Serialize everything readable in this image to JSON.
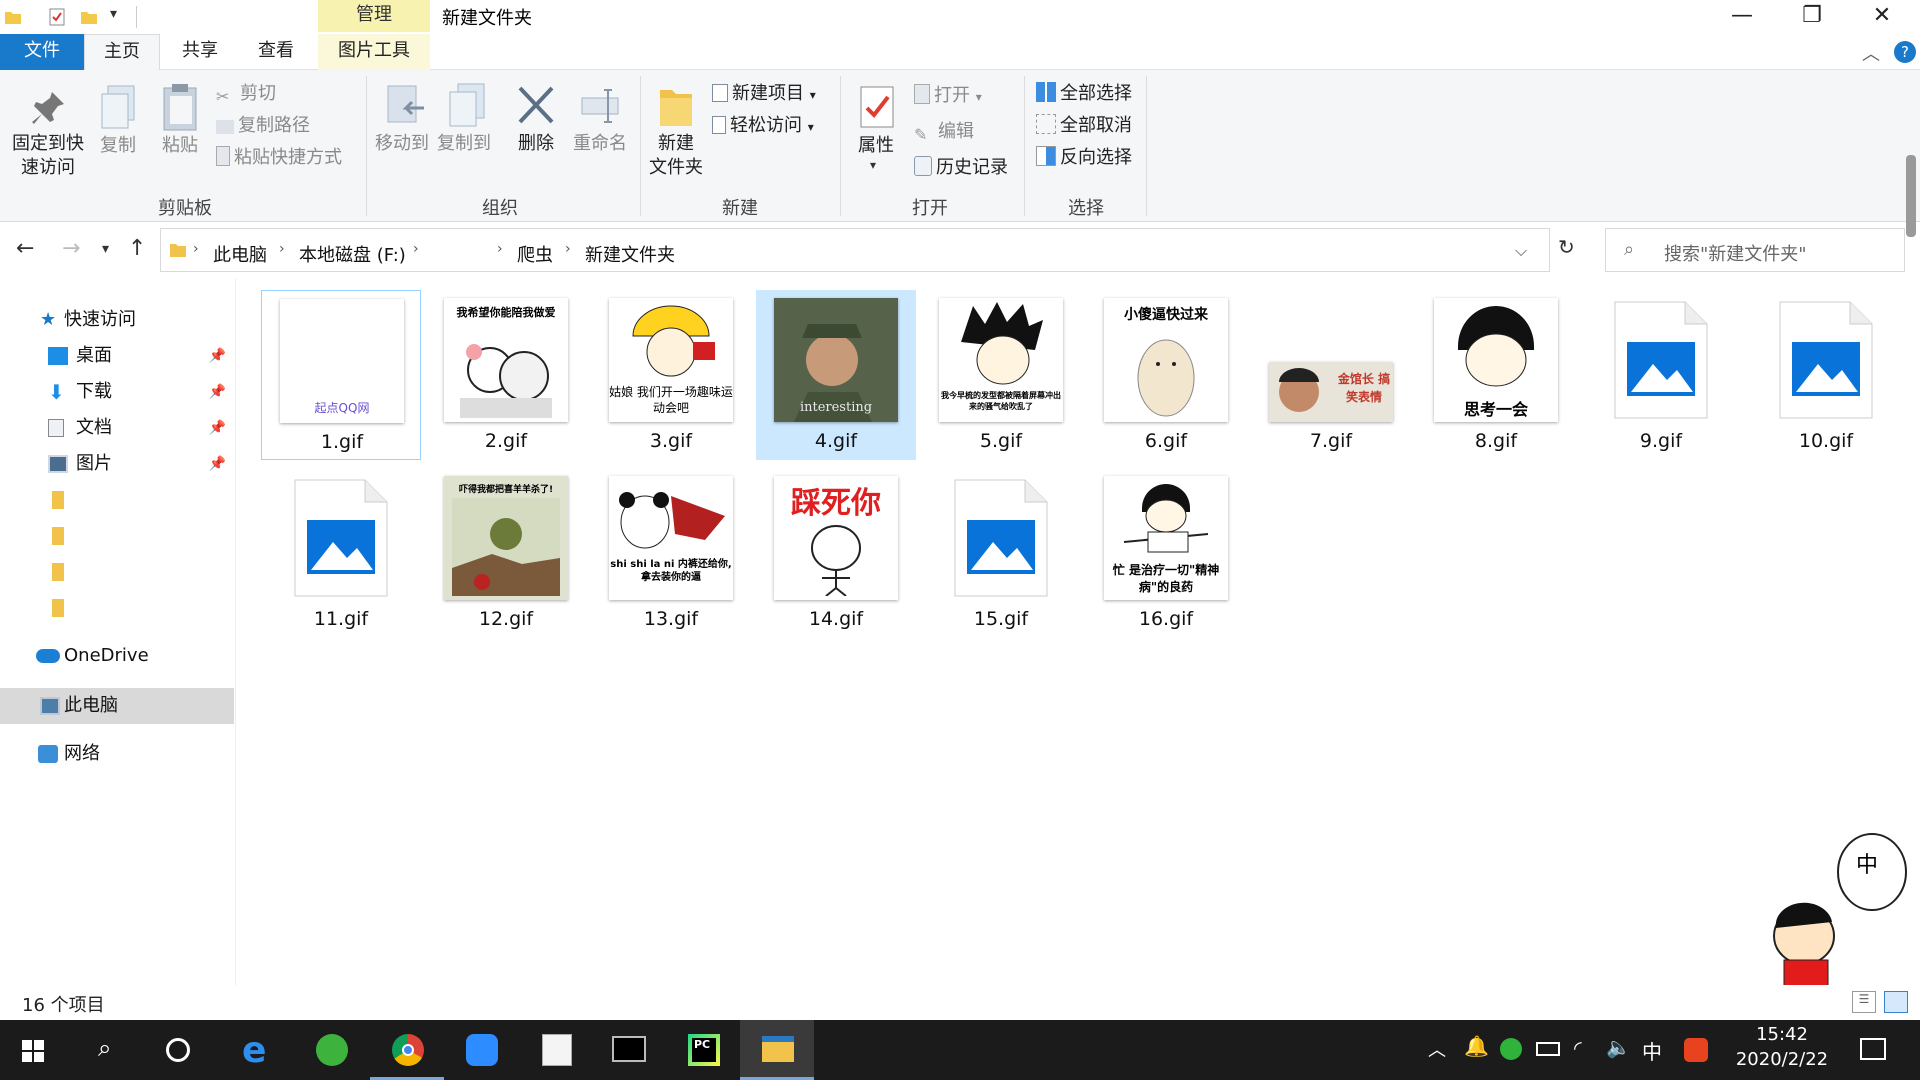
{
  "window": {
    "title": "新建文件夹",
    "context_tab": "管理",
    "minimize_glyph": "—",
    "maximize_glyph": "❐",
    "close_glyph": "✕"
  },
  "tabs": [
    {
      "label": "文件"
    },
    {
      "label": "主页"
    },
    {
      "label": "共享"
    },
    {
      "label": "查看"
    },
    {
      "label": "图片工具"
    }
  ],
  "ribbon": {
    "clipboard": {
      "pin": "固定到快\n速访问",
      "copy": "复制",
      "paste": "粘贴",
      "cut": "剪切",
      "copy_path": "复制路径",
      "paste_shortcut": "粘贴快捷方式",
      "label": "剪贴板"
    },
    "organize": {
      "move_to": "移动到",
      "copy_to": "复制到",
      "delete": "删除",
      "rename": "重命名",
      "label": "组织"
    },
    "new": {
      "new_folder": "新建\n文件夹",
      "new_item": "新建项目",
      "easy_access": "轻松访问",
      "label": "新建"
    },
    "open": {
      "properties": "属性",
      "open": "打开",
      "edit": "编辑",
      "history": "历史记录",
      "label": "打开"
    },
    "select": {
      "select_all": "全部选择",
      "select_none": "全部取消",
      "invert": "反向选择",
      "label": "选择"
    }
  },
  "address": {
    "crumbs": [
      "此电脑",
      "本地磁盘 (F:)",
      "爬虫",
      "新建文件夹"
    ],
    "search_placeholder": "搜索\"新建文件夹\""
  },
  "nav": {
    "quick_access": "快速访问",
    "desktop": "桌面",
    "downloads": "下载",
    "documents": "文档",
    "pictures": "图片",
    "onedrive": "OneDrive",
    "this_pc": "此电脑",
    "network": "网络"
  },
  "files": [
    {
      "name": "1.gif",
      "caption": "起点QQ网"
    },
    {
      "name": "2.gif",
      "caption": "我希望你能陪我做爱"
    },
    {
      "name": "3.gif",
      "caption": "姑娘 我们开一场趣味运动会吧"
    },
    {
      "name": "4.gif",
      "caption": "interesting"
    },
    {
      "name": "5.gif",
      "caption": "我今早梳的发型都被隔着屏幕冲出来的骚气给吹乱了"
    },
    {
      "name": "6.gif",
      "caption": "小傻逼快过来"
    },
    {
      "name": "7.gif",
      "caption": "金馆长 搞笑表情"
    },
    {
      "name": "8.gif",
      "caption": "思考一会"
    },
    {
      "name": "9.gif",
      "caption": ""
    },
    {
      "name": "10.gif",
      "caption": ""
    },
    {
      "name": "11.gif",
      "caption": ""
    },
    {
      "name": "12.gif",
      "caption": "吓得我都把喜羊羊杀了!"
    },
    {
      "name": "13.gif",
      "caption": "shi shi la ni 内裤还给你,拿去装你的逼"
    },
    {
      "name": "14.gif",
      "caption": "踩死你"
    },
    {
      "name": "15.gif",
      "caption": ""
    },
    {
      "name": "16.gif",
      "caption": "忙 是治疗一切\"精神病\"的良药"
    }
  ],
  "status": {
    "item_count": "16 个项目"
  },
  "taskbar": {
    "time": "15:42",
    "date": "2020/2/22",
    "ime": "中"
  },
  "colors": {
    "accent": "#1979ca",
    "selection": "#cce8ff",
    "ribbon_bg": "#f5f6f7",
    "context_tab": "#f7f2b0",
    "taskbar": "#1b1b1b"
  }
}
